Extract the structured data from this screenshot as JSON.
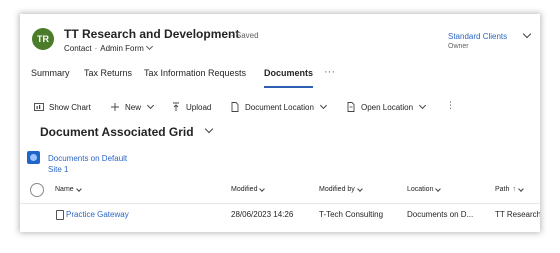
{
  "header": {
    "avatar_initials": "TR",
    "avatar_color": "#4a7c2a",
    "title": "TT Research and Development",
    "saved_status": "- Saved",
    "entity": "Contact",
    "separator": "·",
    "form": "Admin Form",
    "owner_value": "Standard Clients",
    "owner_label": "Owner"
  },
  "tabs": [
    {
      "label": "Summary",
      "active": false
    },
    {
      "label": "Tax Returns",
      "active": false
    },
    {
      "label": "Tax Information Requests",
      "active": false
    },
    {
      "label": "Documents",
      "active": true
    }
  ],
  "tabs_more": "···",
  "commands": {
    "show_chart": "Show Chart",
    "new": "New",
    "upload": "Upload",
    "document_location": "Document Location",
    "open_location": "Open Location",
    "more": "⋮"
  },
  "grid": {
    "title": "Document Associated Grid",
    "location_line1": "Documents on Default",
    "location_line2": "Site 1",
    "columns": {
      "name": "Name",
      "modified": "Modified",
      "modified_by": "Modified by",
      "location": "Location",
      "path": "Path",
      "path_sort": "↑"
    },
    "rows": [
      {
        "name": "Practice Gateway",
        "modified": "28/06/2023 14:26",
        "modified_by": "T-Tech Consulting",
        "location": "Documents on D...",
        "path": "TT Research"
      }
    ]
  },
  "colors": {
    "accent": "#2f5fb3",
    "link": "#2b66c6"
  }
}
